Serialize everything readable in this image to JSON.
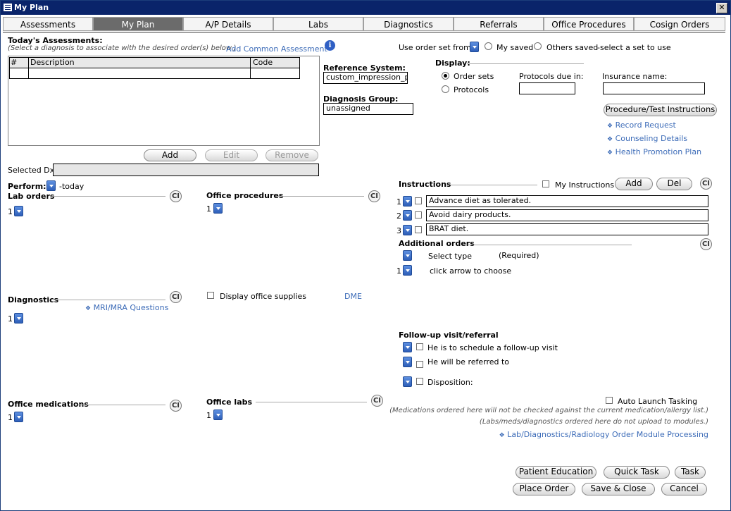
{
  "window": {
    "title": "My Plan",
    "close_glyph": "✕"
  },
  "tabs": [
    "Assessments",
    "My Plan",
    "A/P Details",
    "Labs",
    "Diagnostics",
    "Referrals",
    "Office Procedures",
    "Cosign Orders"
  ],
  "assessments": {
    "title": "Today's Assessments:",
    "subtitle": "(Select a diagnosis to associate with the desired order(s) below.)",
    "add_common": "Add Common Assessment",
    "columns": [
      "#",
      "Description",
      "Code"
    ],
    "buttons": {
      "add": "Add",
      "edit": "Edit",
      "remove": "Remove"
    },
    "selected_dx_label": "Selected Dx:",
    "selected_dx_value": ""
  },
  "reference": {
    "label": "Reference System:",
    "value": "custom_impression_pl",
    "dg_label": "Diagnosis Group:",
    "dg_value": "unassigned"
  },
  "order_set": {
    "use_label": "Use order set from:",
    "my_saved": "My saved",
    "others_saved": "Others saved",
    "hint": "-select a set to use"
  },
  "display": {
    "label": "Display:",
    "order_sets": "Order sets",
    "protocols": "Protocols",
    "protocols_due": "Protocols due in:",
    "protocols_due_value": "",
    "insurance": "Insurance name:",
    "insurance_value": ""
  },
  "proc_btn": "Procedure/Test Instructions",
  "links": [
    "Record Request",
    "Counseling Details",
    "Health Promotion Plan"
  ],
  "perform": {
    "label": "Perform:",
    "value": "-today"
  },
  "lab_orders": {
    "label": "Lab orders",
    "count": "1"
  },
  "office_procedures": {
    "label": "Office procedures",
    "count": "1"
  },
  "instructions": {
    "label": "Instructions",
    "my_instructions": "My Instructions",
    "add": "Add",
    "del": "Del",
    "items": [
      {
        "n": "1",
        "text": "Advance diet as tolerated."
      },
      {
        "n": "2",
        "text": "Avoid dairy products."
      },
      {
        "n": "3",
        "text": "BRAT diet."
      }
    ]
  },
  "additional_orders": {
    "label": "Additional orders",
    "select_type": "Select type",
    "required": "(Required)",
    "n": "1",
    "choose": "click arrow to choose"
  },
  "diagnostics": {
    "label": "Diagnostics",
    "mri": "MRI/MRA Questions",
    "count": "1"
  },
  "supplies": {
    "label": "Display office supplies",
    "dme": "DME"
  },
  "followup": {
    "label": "Follow-up visit/referral",
    "schedule": "He is to schedule a follow-up visit",
    "referred": "He will be referred to",
    "disposition": "Disposition:"
  },
  "office_medications": {
    "label": "Office medications",
    "count": "1"
  },
  "office_labs": {
    "label": "Office labs",
    "count": "1"
  },
  "auto_launch": "Auto Launch Tasking",
  "notes": [
    "(Medications ordered here will not be checked against the current medication/allergy list.)",
    "(Labs/meds/diagnostics ordered here do not upload to modules.)"
  ],
  "lab_link": "Lab/Diagnostics/Radiology Order Module Processing",
  "bottom_buttons": {
    "patient_education": "Patient Education",
    "quick_task": "Quick Task",
    "task": "Task",
    "place_order": "Place Order",
    "save_close": "Save & Close",
    "cancel": "Cancel"
  },
  "icons": {
    "ci": "CI",
    "info": "i",
    "diamond": "❖"
  }
}
